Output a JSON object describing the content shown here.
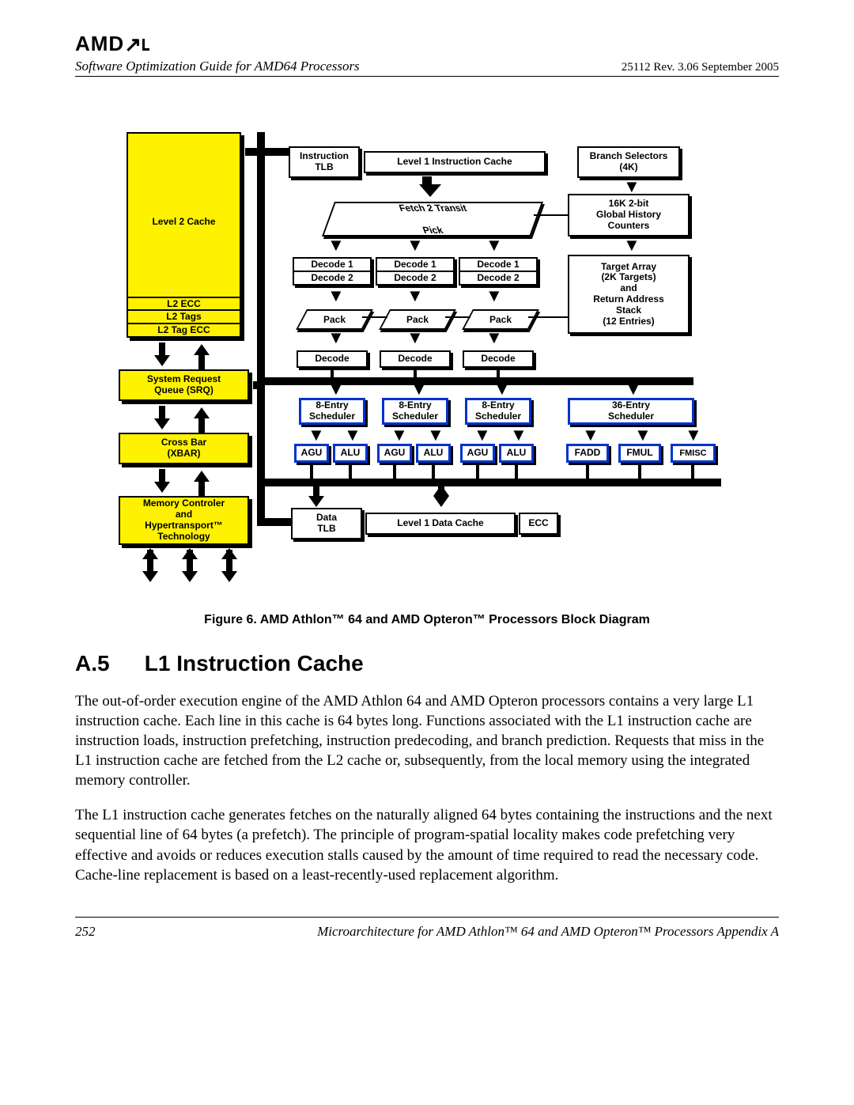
{
  "logo": "AMD",
  "header": {
    "doc_title": "Software Optimization Guide for AMD64 Processors",
    "rev_line": "25112   Rev. 3.06   September 2005"
  },
  "diagram": {
    "l2_cache": "Level 2 Cache",
    "l2_ecc": "L2 ECC",
    "l2_tags": "L2 Tags",
    "l2_tag_ecc": "L2 Tag ECC",
    "srq_l1": "System Request",
    "srq_l2": "Queue (SRQ)",
    "xbar_l1": "Cross Bar",
    "xbar_l2": "(XBAR)",
    "mem_l1": "Memory Controler",
    "mem_l2": "and",
    "mem_l3": "Hypertransport™",
    "mem_l4": "Technology",
    "itlb_l1": "Instruction",
    "itlb_l2": "TLB",
    "l1i": "Level 1 Instruction Cache",
    "branch_sel_l1": "Branch Selectors",
    "branch_sel_l2": "(4K)",
    "ghc_l1": "16K 2-bit",
    "ghc_l2": "Global History",
    "ghc_l3": "Counters",
    "target_l1": "Target Array",
    "target_l2": "(2K Targets)",
    "target_l3": "and",
    "target_l4": "Return Address",
    "target_l5": "Stack",
    "target_l6": "(12 Entries)",
    "fetch_l1": "Fetch 2 Transit",
    "fetch_l2": "Pick",
    "decode1": "Decode 1",
    "decode2": "Decode 2",
    "pack": "Pack",
    "decode": "Decode",
    "sched8_l1": "8-Entry",
    "sched8_l2": "Scheduler",
    "sched36_l1": "36-Entry",
    "sched36_l2": "Scheduler",
    "agu": "AGU",
    "alu": "ALU",
    "fadd": "FADD",
    "fmul": "FMUL",
    "fmisc": "FMISC",
    "dtlb_l1": "Data",
    "dtlb_l2": "TLB",
    "l1d": "Level 1 Data Cache",
    "ecc": "ECC"
  },
  "caption": "Figure 6.    AMD Athlon™ 64 and AMD Opteron™ Processors Block Diagram",
  "section": {
    "num": "A.5",
    "title": "L1 Instruction Cache"
  },
  "paragraph1": "The out-of-order execution engine of the AMD Athlon 64 and AMD Opteron processors contains a very large L1 instruction cache. Each line in this cache is 64 bytes long. Functions associated with the L1 instruction cache are instruction loads, instruction prefetching, instruction predecoding, and branch prediction. Requests that miss in the L1 instruction cache are fetched from the L2 cache or, subsequently, from the local memory using the integrated memory controller.",
  "paragraph2": "The L1 instruction cache generates fetches on the naturally aligned 64 bytes containing the instructions and the next sequential line of 64 bytes (a prefetch). The principle of program-spatial locality makes code prefetching very effective and avoids or reduces execution stalls caused by the amount of time required to read the necessary code. Cache-line replacement is based on a least-recently-used replacement algorithm.",
  "footer": {
    "page": "252",
    "right": "Microarchitecture for AMD Athlon™ 64 and AMD Opteron™ Processors   Appendix A"
  }
}
